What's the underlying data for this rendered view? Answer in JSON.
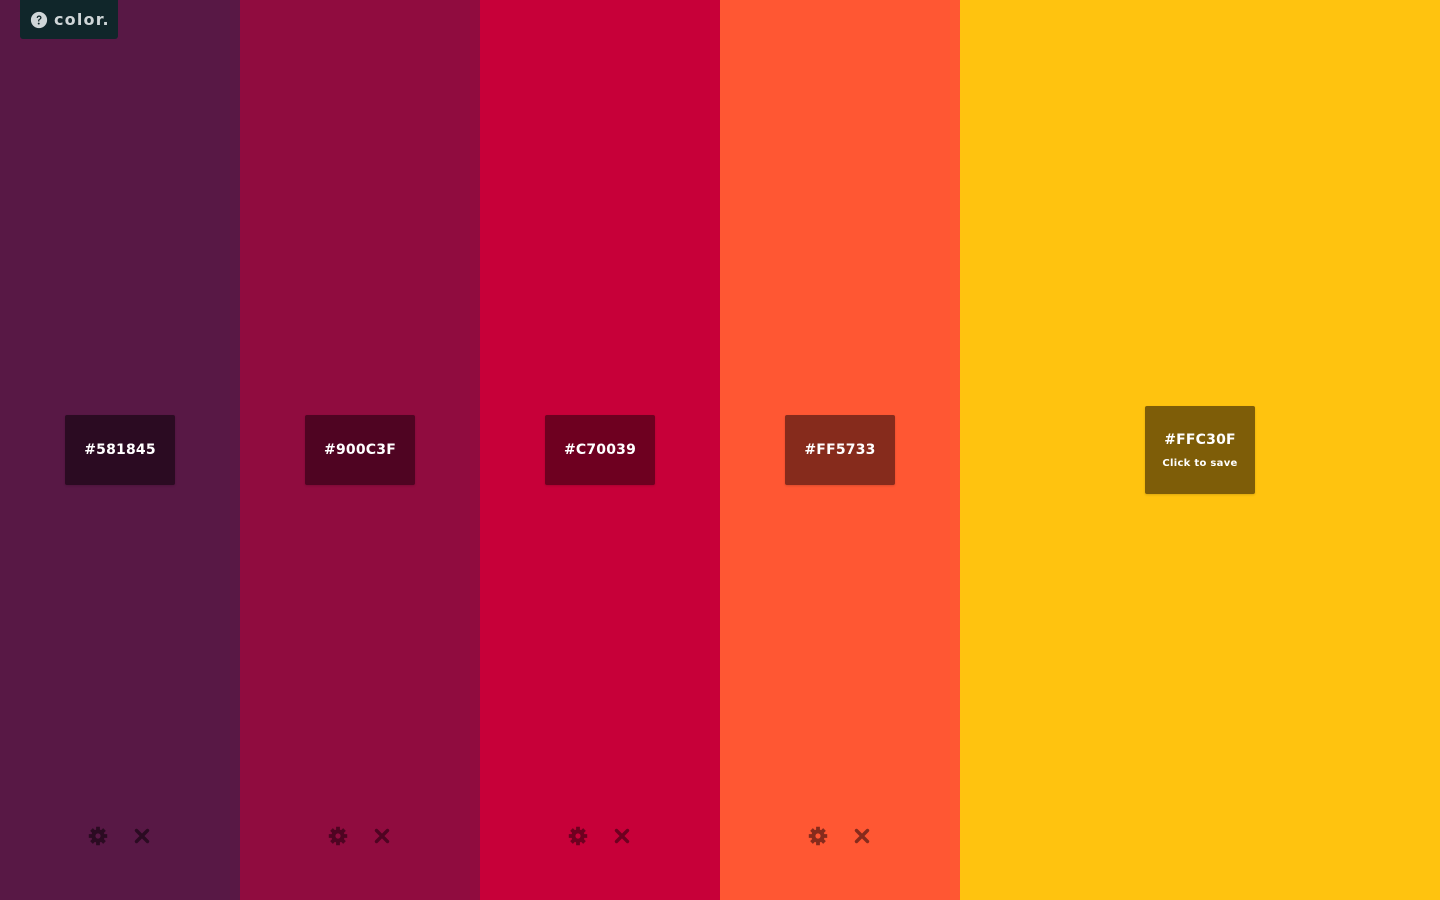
{
  "brand": {
    "icon": "question-circle-icon",
    "text": "color."
  },
  "columns": [
    {
      "hex": "#581845",
      "color": "#581845",
      "label_bg": "#2b0b22",
      "icon_color": "#2b0b22",
      "controls": [
        "gear-icon",
        "close-icon"
      ]
    },
    {
      "hex": "#900C3F",
      "color": "#900C3F",
      "label_bg": "#4f0422",
      "icon_color": "#4f0422",
      "controls": [
        "gear-icon",
        "close-icon"
      ]
    },
    {
      "hex": "#C70039",
      "color": "#C70039",
      "label_bg": "#6e0020",
      "icon_color": "#6e0020",
      "controls": [
        "gear-icon",
        "close-icon"
      ]
    },
    {
      "hex": "#FF5733",
      "color": "#FF5733",
      "label_bg": "#862b1c",
      "icon_color": "#862b1c",
      "controls": [
        "gear-icon",
        "close-icon"
      ]
    },
    {
      "hex": "#FFC30F",
      "color": "#FFC30F",
      "label_bg": "#7e5d08",
      "hint": "Click to save"
    }
  ]
}
